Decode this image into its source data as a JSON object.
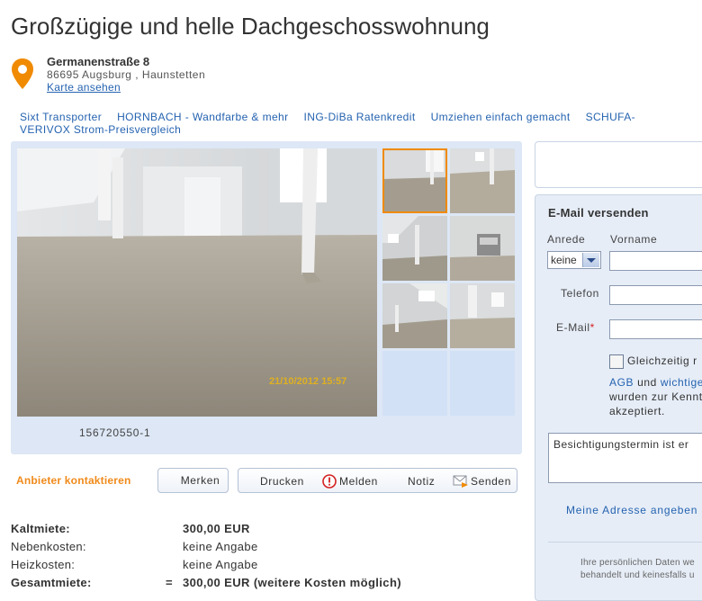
{
  "listing": {
    "title": "Großzügige und helle Dachgeschosswohnung",
    "street": "Germanenstraße 8",
    "city": "86695 Augsburg , Haunstetten",
    "map_link": "Karte ansehen"
  },
  "ad_links": [
    "Sixt Transporter",
    "HORNBACH - Wandfarbe & mehr",
    "ING-DiBa Ratenkredit",
    "Umziehen einfach gemacht",
    "SCHUFA-",
    "VERIVOX Strom-Preisvergleich"
  ],
  "gallery": {
    "photo_timestamp": "21/10/2012 15:57",
    "image_id": "156720550-1"
  },
  "actions": {
    "contact": "Anbieter kontaktieren",
    "save": "Merken",
    "print": "Drucken",
    "report": "Melden",
    "note": "Notiz",
    "send": "Senden"
  },
  "costs": [
    {
      "label": "Kaltmiete:",
      "value": "300,00 EUR",
      "bold": true
    },
    {
      "label": "Nebenkosten:",
      "value": "keine Angabe",
      "bold": false
    },
    {
      "label": "Heizkosten:",
      "value": "keine Angabe",
      "bold": false
    },
    {
      "label": "Gesamtmiete:",
      "value": "300,00 EUR (weitere Kosten möglich)",
      "bold": true,
      "prefix": "="
    }
  ],
  "email_form": {
    "title": "E-Mail versenden",
    "salutation_label": "Anrede",
    "salutation_value": "keine",
    "firstname_label": "Vorname",
    "phone_label": "Telefon",
    "email_label": "E-Mail",
    "required_mark": "*",
    "copy_checkbox": "Gleichzeitig r",
    "agb_link": "AGB",
    "agb_and": " und ",
    "agb_link2": "wichtige",
    "agb_line2": "wurden zur Kennt",
    "agb_line3": "akzeptiert.",
    "message": "Besichtigungstermin ist er",
    "address_link": "Meine Adresse angeben",
    "privacy_line1": "Ihre persönlichen Daten we",
    "privacy_line2": "behandelt und keinesfalls u"
  },
  "colors": {
    "accent_orange": "#f08a00",
    "link_blue": "#2563b0",
    "panel_blue": "#dde7f5"
  }
}
